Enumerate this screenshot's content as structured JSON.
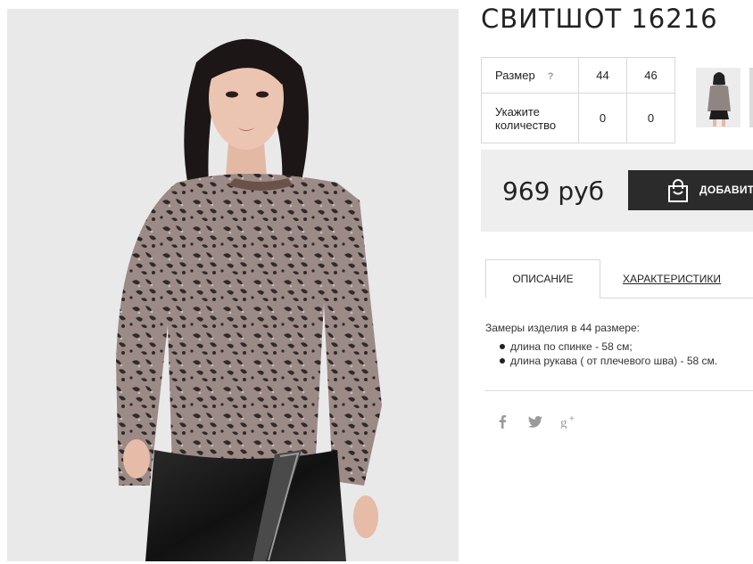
{
  "product": {
    "title": "СВИТШОТ 16216"
  },
  "size_table": {
    "size_label": "Размер",
    "help_mark": "?",
    "sizes": [
      "44",
      "46"
    ],
    "quantity_label": "Укажите количество",
    "quantities": [
      "0",
      "0"
    ]
  },
  "price": {
    "value": "969 руб"
  },
  "cart": {
    "add_label": "ДОБАВИТ",
    "icon": "shopping-bag-icon"
  },
  "tabs": [
    {
      "label": "ОПИСАНИЕ",
      "active": true
    },
    {
      "label": "ХАРАКТЕРИСТИКИ",
      "active": false
    }
  ],
  "description": {
    "intro": "Замеры изделия в 44 размере:",
    "items": [
      "длина по спинке - 58 см;",
      "длина рукава ( от плечевого шва) - 58 см."
    ]
  },
  "social": {
    "icons": [
      "facebook-icon",
      "twitter-icon",
      "google-plus-icon"
    ]
  },
  "colors": {
    "button_bg": "#2b2b2b",
    "price_box_bg": "#eeeeee",
    "photo_bg": "#e9e9ea",
    "social_icon": "#999999"
  }
}
